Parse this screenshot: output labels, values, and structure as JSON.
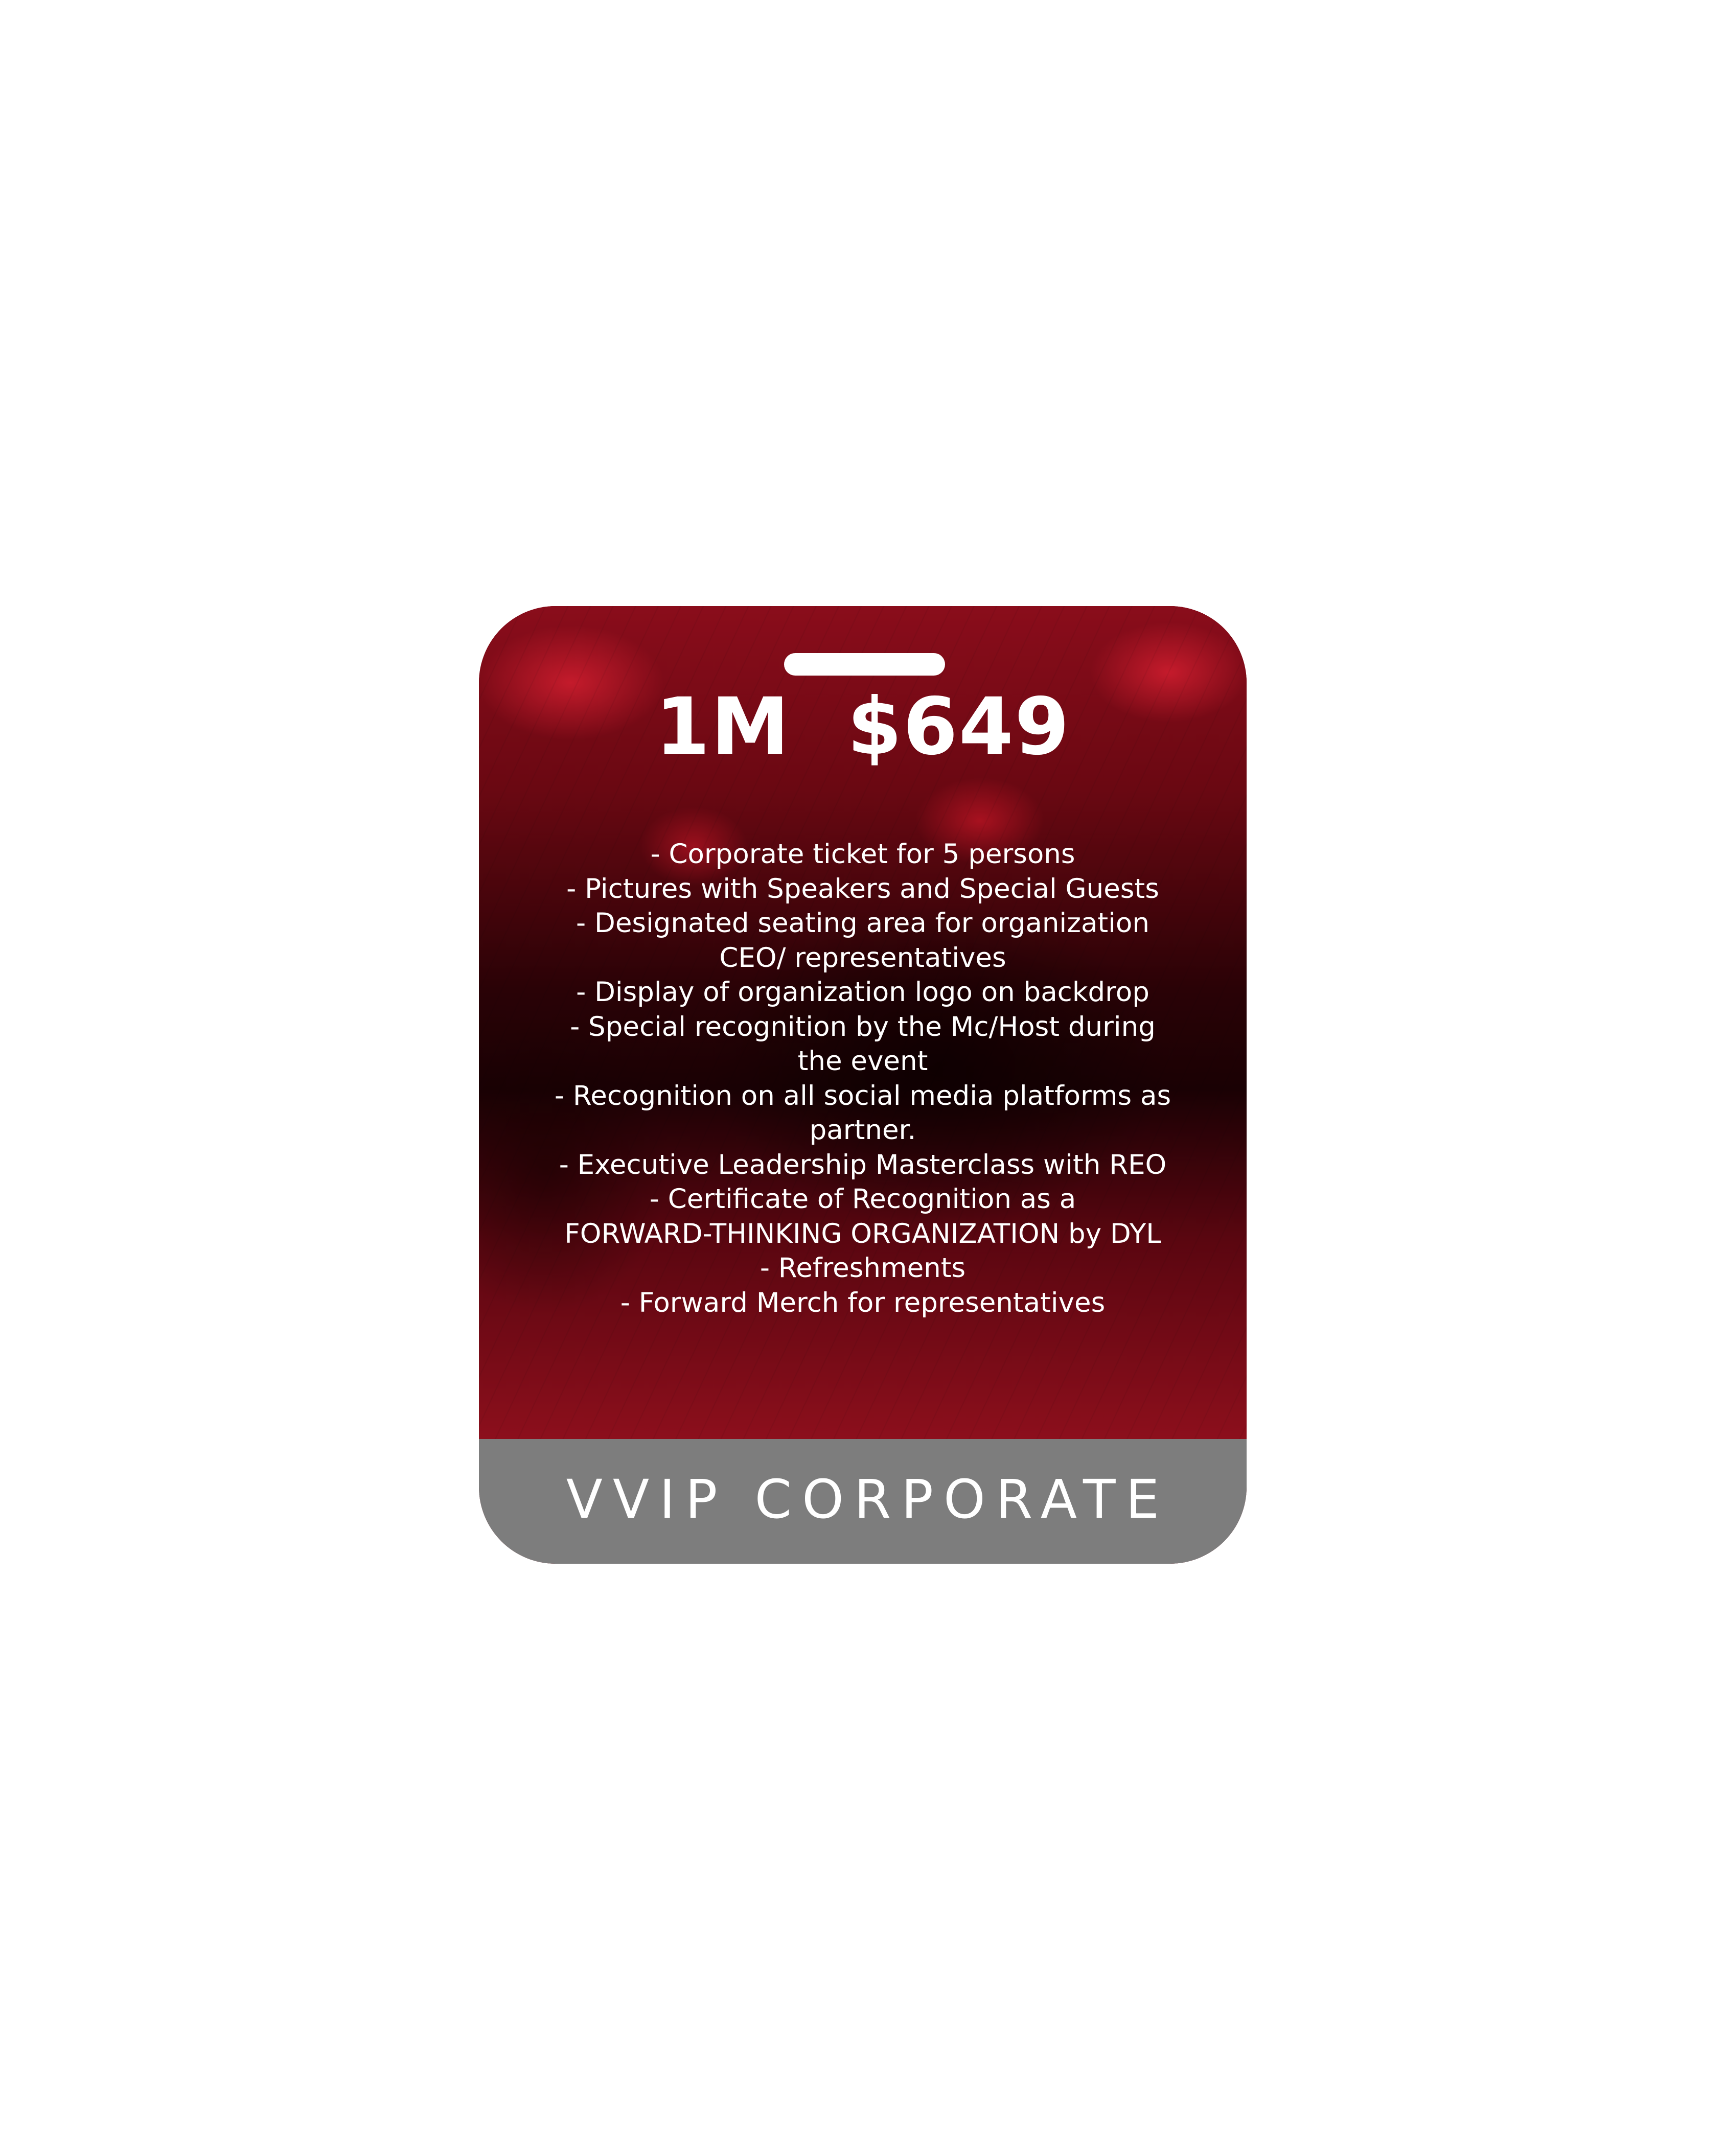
{
  "badge": {
    "price": "1M  $649",
    "features": [
      "- Corporate ticket for  5 persons",
      "- Pictures with Speakers and Special Guests",
      "- Designated seating area for organization\nCEO/ representatives",
      "- Display of organization logo on backdrop",
      "- Special recognition by the Mc/Host during\nthe event",
      "- Recognition on all social media platforms as\npartner.",
      "- Executive Leadership Masterclass with REO",
      "- Certificate of Recognition as a\nFORWARD-THINKING ORGANIZATION by DYL",
      "-  Refreshments",
      "- Forward Merch for representatives"
    ],
    "tier_label": "VVIP CORPORATE"
  },
  "colors": {
    "badge_red": "#8a0d1b",
    "footer_gray": "#7d7d7d",
    "text": "#ffffff"
  }
}
